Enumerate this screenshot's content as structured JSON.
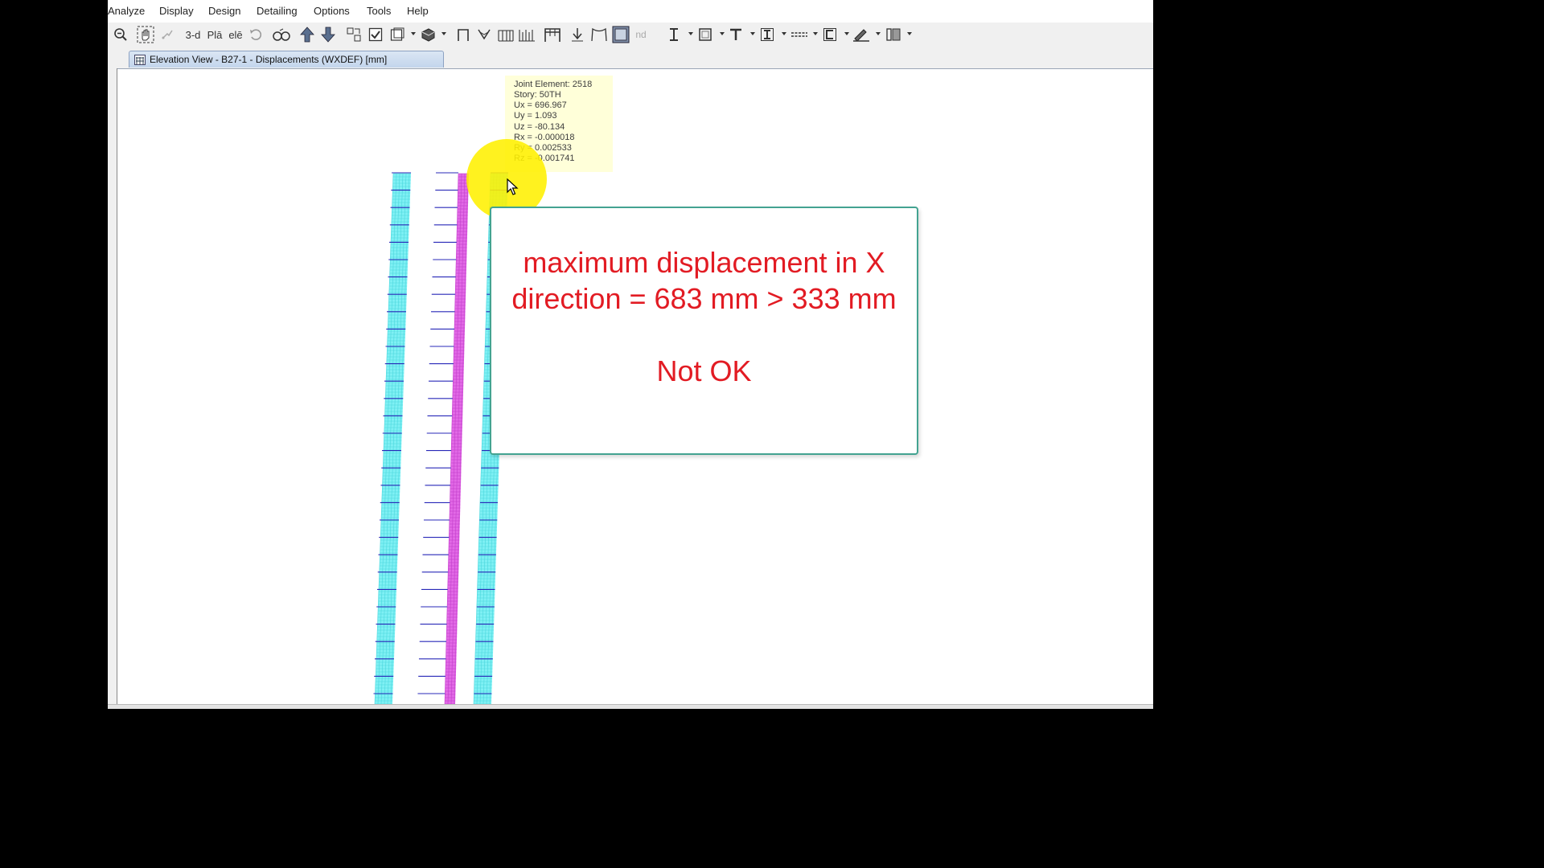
{
  "menu": [
    "Analyze",
    "Display",
    "Design",
    "Detailing",
    "Options",
    "Tools",
    "Help"
  ],
  "toolbar": {
    "labels": [
      "3-d",
      "Plā",
      "elē",
      "nd"
    ],
    "icons": [
      "zoom-out-icon",
      "pan-icon",
      "restore-view-icon",
      "3d-view-button",
      "plan-view-button",
      "elevation-view-button",
      "rotate-icon",
      "perspective-icon",
      "move-up-icon",
      "move-down-icon",
      "object-shrink-icon",
      "select-icon",
      "set-display-options-icon",
      "object-fill-icon",
      "frame-icon",
      "brace-icon",
      "wall-icon",
      "wall-stack-icon",
      "beam-icon",
      "point-load-icon",
      "deformed-shape-icon",
      "grid-display-icon",
      "section-i-icon",
      "area-icon",
      "t-section-icon",
      "i-section-icon",
      "dimension-icon",
      "channel-icon",
      "draw-icon",
      "column-icon"
    ]
  },
  "tab": {
    "title": "Elevation View - B27-1   - Displacements (WXDEF)  [mm]"
  },
  "tooltip": {
    "lines": [
      "Joint Element: 2518",
      "Story: 50TH",
      "Ux =  696.967",
      "Uy =  1.093",
      "Uz = -80.134",
      "Rx = -0.000018",
      "Ry =  0.002533",
      "Rz = -0.001741"
    ]
  },
  "note": {
    "main": "maximum displacement in X direction = 683 mm > 333 mm",
    "status": "Not OK"
  },
  "colors": {
    "wall_fill": "#7ff0f4",
    "wall_mesh": "#4cd7de",
    "core_fill": "#e26ae6",
    "core_mesh": "#c43fcd",
    "slab_line": "#2828b8",
    "note_text": "#e21b23",
    "note_border": "#43a391",
    "highlight": "#fff000"
  }
}
